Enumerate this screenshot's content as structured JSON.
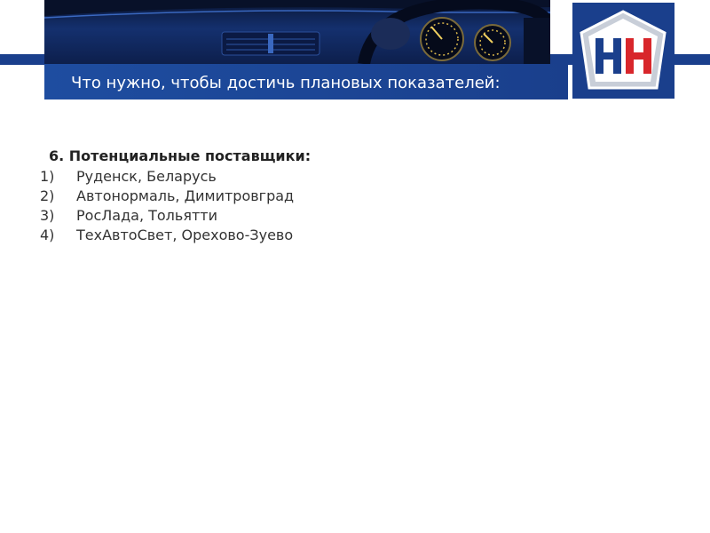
{
  "header": {
    "title": "Что нужно, чтобы достичь плановых показателей:",
    "logo_text": "НН",
    "colors": {
      "band": "#1a3f8c",
      "logo_bg": "#1a3f8c",
      "logo_red": "#d8262b"
    }
  },
  "content": {
    "heading": "6. Потенциальные поставщики:",
    "items": [
      {
        "num": "1)",
        "text": "Руденск, Беларусь"
      },
      {
        "num": "2)",
        "text": "Автонормаль, Димитровград"
      },
      {
        "num": "3)",
        "text": "РосЛада, Тольятти"
      },
      {
        "num": "4)",
        "text": "ТехАвтоСвет, Орехово-Зуево"
      }
    ]
  }
}
